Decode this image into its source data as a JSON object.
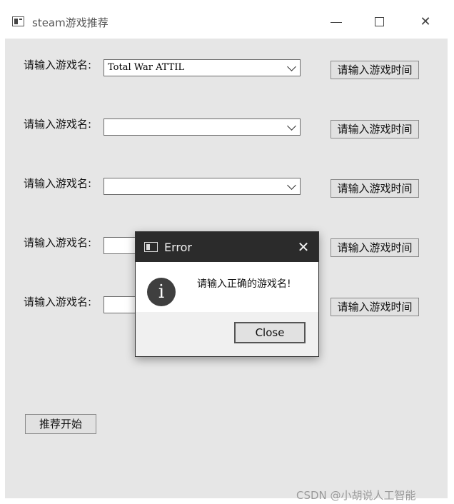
{
  "window": {
    "title": "steam游戏推荐"
  },
  "rows": [
    {
      "label": "请输入游戏名:",
      "value": "Total War ATTIL",
      "button": "请输入游戏时间"
    },
    {
      "label": "请输入游戏名:",
      "value": "",
      "button": "请输入游戏时间"
    },
    {
      "label": "请输入游戏名:",
      "value": "",
      "button": "请输入游戏时间"
    },
    {
      "label": "请输入游戏名:",
      "value": "",
      "button": "请输入游戏时间"
    },
    {
      "label": "请输入游戏名:",
      "value": "",
      "button": "请输入游戏时间"
    }
  ],
  "start_button": "推荐开始",
  "dialog": {
    "title": "Error",
    "message": "请输入正确的游戏名!",
    "ok_label": "Close",
    "close_glyph": "✕",
    "icon_glyph": "i"
  },
  "watermark": "CSDN @小胡说人工智能"
}
